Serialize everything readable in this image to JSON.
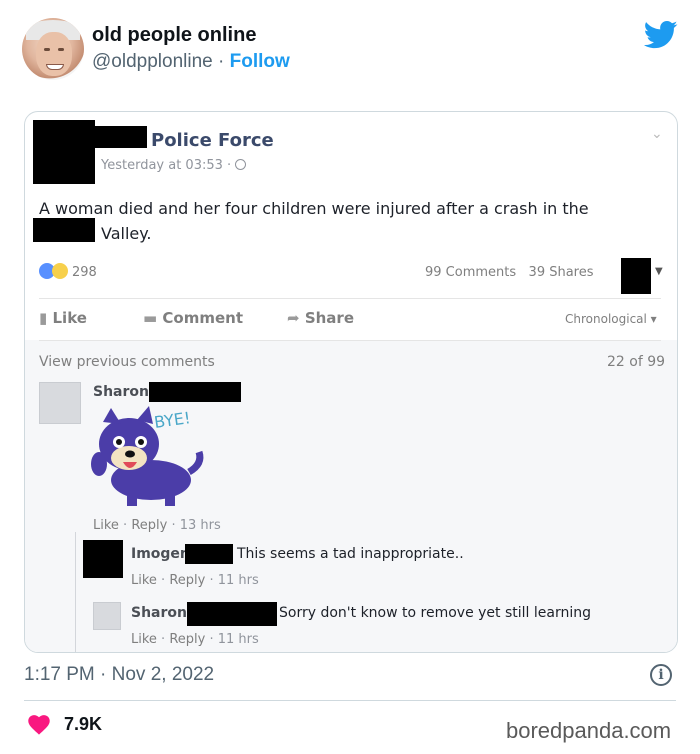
{
  "tweet": {
    "author_name": "old people online",
    "author_handle": "@oldpplonline",
    "separator": " · ",
    "follow_label": "Follow",
    "timestamp": "1:17 PM · Nov 2, 2022",
    "likes": "7.9K",
    "info_icon": "info-icon",
    "brand_color": "#1d9bf0",
    "heart_color": "#f91880"
  },
  "fb_post": {
    "page_name": "Police Force",
    "time": "Yesterday at 03:53 · ",
    "text_line1": "A woman died and her four children were injured after a crash in the",
    "text_line2": "Valley.",
    "reactions_count": "298",
    "comments_count": "99 Comments",
    "shares_count": "39 Shares",
    "actions": {
      "like": "Like",
      "comment": "Comment",
      "share": "Share"
    },
    "sort": "Chronological ▾",
    "view_previous": "View previous comments",
    "comment_position": "22 of 99",
    "comments": [
      {
        "name": "Sharon",
        "sticker_text": "BYE!",
        "like": "Like",
        "reply": "Reply",
        "age": "13 hrs"
      },
      {
        "name": "Imogen",
        "text": "This seems a tad inappropriate..",
        "like": "Like",
        "reply": "Reply",
        "age": "11 hrs"
      },
      {
        "name": "Sharon",
        "text": "Sorry don't know to remove yet still learning",
        "like": "Like",
        "reply": "Reply",
        "age": "11 hrs"
      }
    ]
  },
  "watermark": "boredpanda.com"
}
